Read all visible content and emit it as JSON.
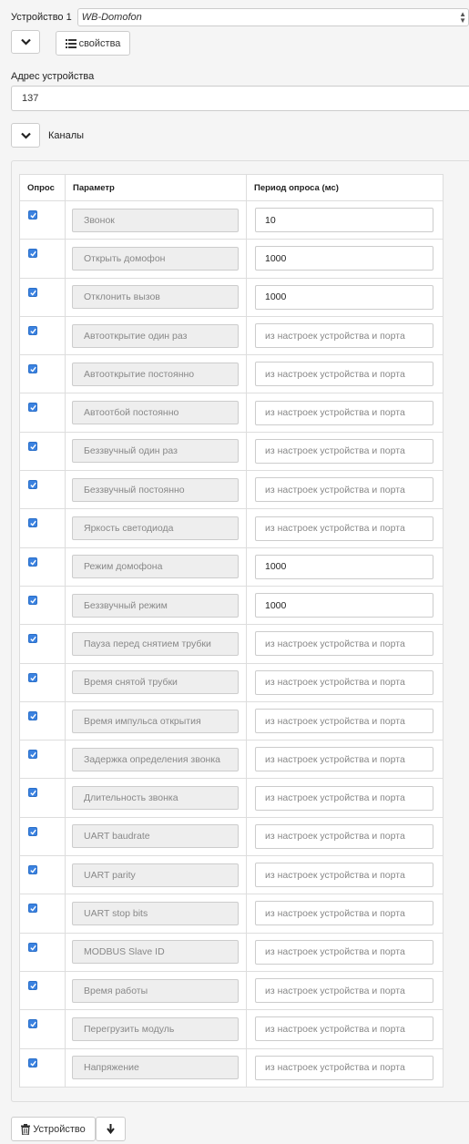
{
  "device": {
    "label": "Устройство 1",
    "model": "WB-Domofon"
  },
  "properties_button": "свойства",
  "address": {
    "label": "Адрес устройства",
    "value": "137"
  },
  "channels": {
    "label": "Каналы",
    "headers": {
      "poll": "Опрос",
      "param": "Параметр",
      "period": "Период опроса (мс)"
    },
    "default_placeholder": "из настроек устройства и порта",
    "rows": [
      {
        "name": "Звонок",
        "checked": true,
        "period": "10"
      },
      {
        "name": "Открыть домофон",
        "checked": true,
        "period": "1000"
      },
      {
        "name": "Отклонить вызов",
        "checked": true,
        "period": "1000"
      },
      {
        "name": "Автооткрытие один раз",
        "checked": true,
        "period": ""
      },
      {
        "name": "Автооткрытие постоянно",
        "checked": true,
        "period": ""
      },
      {
        "name": "Автоотбой постоянно",
        "checked": true,
        "period": ""
      },
      {
        "name": "Беззвучный один раз",
        "checked": true,
        "period": ""
      },
      {
        "name": "Беззвучный постоянно",
        "checked": true,
        "period": ""
      },
      {
        "name": "Яркость светодиода",
        "checked": true,
        "period": ""
      },
      {
        "name": "Режим домофона",
        "checked": true,
        "period": "1000"
      },
      {
        "name": "Беззвучный режим",
        "checked": true,
        "period": "1000"
      },
      {
        "name": "Пауза перед снятием трубки",
        "checked": true,
        "period": ""
      },
      {
        "name": "Время снятой трубки",
        "checked": true,
        "period": ""
      },
      {
        "name": "Время импульса открытия",
        "checked": true,
        "period": ""
      },
      {
        "name": "Задержка определения звонка",
        "checked": true,
        "period": ""
      },
      {
        "name": "Длительность звонка",
        "checked": true,
        "period": ""
      },
      {
        "name": "UART baudrate",
        "checked": true,
        "period": ""
      },
      {
        "name": "UART parity",
        "checked": true,
        "period": ""
      },
      {
        "name": "UART stop bits",
        "checked": true,
        "period": ""
      },
      {
        "name": "MODBUS Slave ID",
        "checked": true,
        "period": ""
      },
      {
        "name": "Время работы",
        "checked": true,
        "period": ""
      },
      {
        "name": "Перегрузить модуль",
        "checked": true,
        "period": ""
      },
      {
        "name": "Напряжение",
        "checked": true,
        "period": ""
      }
    ]
  },
  "delete_device_button": "Устройство",
  "icons": {
    "collapse": "chevron-down-icon",
    "properties": "list-icon",
    "delete": "trash-icon",
    "move_down": "arrow-down-icon",
    "checkbox": "check-icon"
  },
  "colors": {
    "accent": "#3b82e0"
  }
}
